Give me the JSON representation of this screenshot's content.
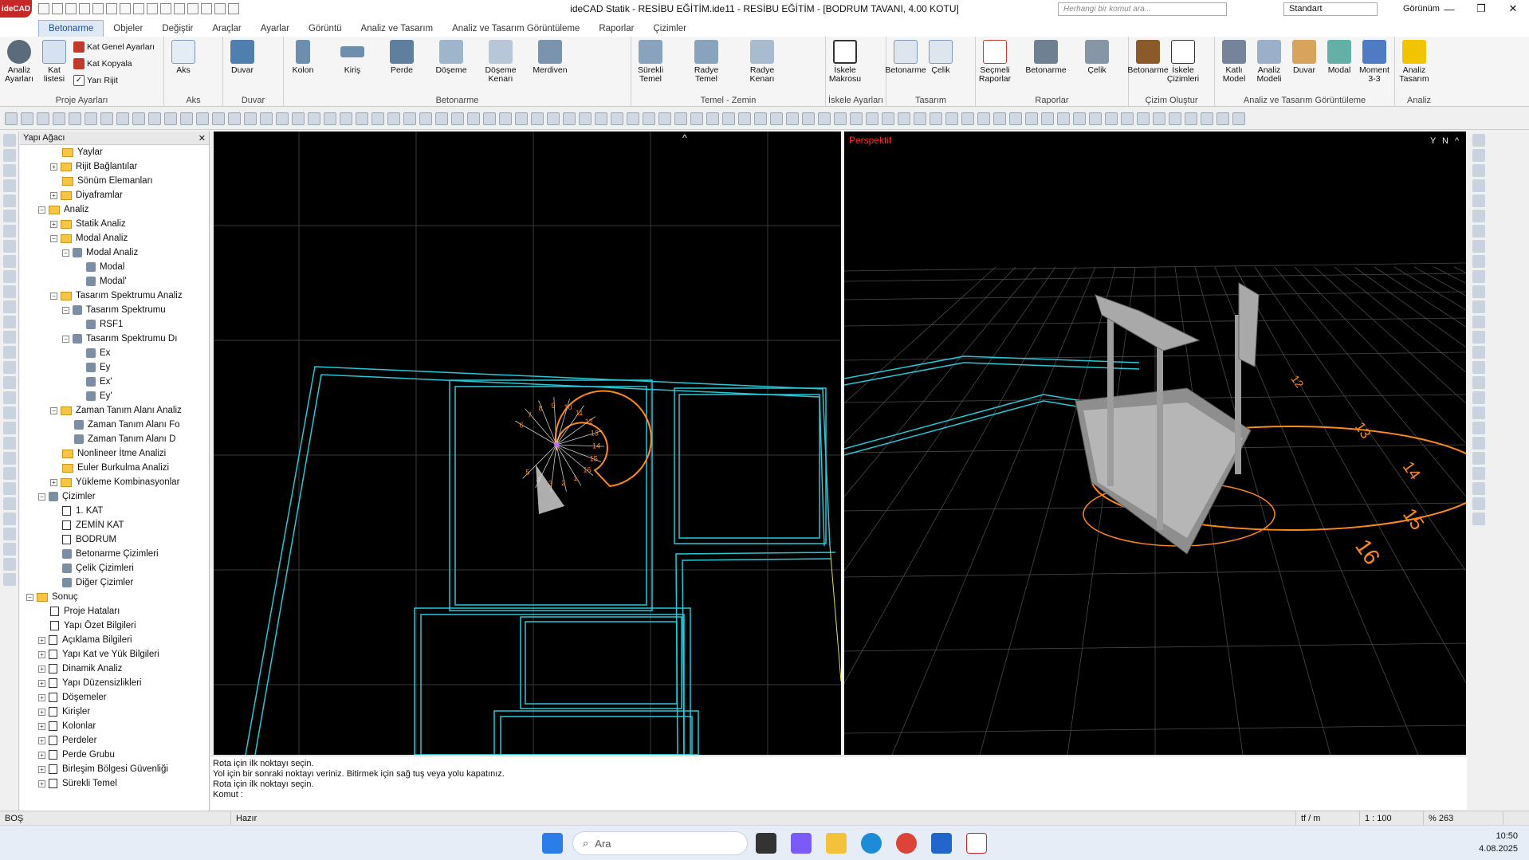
{
  "window": {
    "title": "ideCAD Statik - RESİBU EĞİTİM.ide11 - RESİBU EĞİTİM - [BODRUM TAVANI,  4.00 KOTU]",
    "logo": "ideCAD",
    "minimize": "—",
    "maximize": "❐",
    "close": "✕"
  },
  "tabs": [
    "Betonarme",
    "Objeler",
    "Değiştir",
    "Araçlar",
    "Ayarlar",
    "Görüntü",
    "Analiz ve Tasarım",
    "Analiz ve Tasarım Görüntüleme",
    "Raporlar",
    "Çizimler"
  ],
  "search": {
    "placeholder": "Herhangi bir komut ara..."
  },
  "style_select": "Standart",
  "view_menu": "Görünüm",
  "ribbon": {
    "proje": {
      "title": "Proje Ayarları",
      "analiz": "Analiz Ayarları",
      "kat": "Kat listesi",
      "kat_genel": "Kat Genel Ayarları",
      "kat_kopyala": "Kat Kopyala",
      "yari_rijit": "Yarı Rijit"
    },
    "aks": {
      "title": "Aks",
      "aks": "Aks"
    },
    "duvar": {
      "title": "Duvar",
      "duvar": "Duvar"
    },
    "betonarme": {
      "title": "Betonarme",
      "kolon": "Kolon",
      "kiris": "Kiriş",
      "perde": "Perde",
      "doseme": "Döşeme",
      "doseme_kenari": "Döşeme Kenarı",
      "merdiven": "Merdiven"
    },
    "temel": {
      "title": "Temel - Zemin",
      "surekli": "Sürekli Temel",
      "radye": "Radye Temel",
      "radye_kenari": "Radye Kenarı"
    },
    "iskele": {
      "title": "İskele Ayarları",
      "makrosu": "İskele Makrosu"
    },
    "tasarim": {
      "title": "Tasarım",
      "betonarme": "Betonarme",
      "celik": "Çelik"
    },
    "raporlar": {
      "title": "Raporlar",
      "secmeli": "Seçmeli Raporlar",
      "betonarme": "Betonarme",
      "celik": "Çelik"
    },
    "cizim": {
      "title": "Çizim Oluştur",
      "betonarme": "Betonarme",
      "iskele": "İskele Çizimleri"
    },
    "goruntuleme": {
      "title": "Analiz ve Tasarım Görüntüleme",
      "katli": "Katlı Model",
      "analiz_modeli": "Analiz Modeli",
      "duvar": "Duvar",
      "modal": "Modal",
      "moment": "Moment 3-3"
    },
    "analiz": {
      "title": "Analiz",
      "analiz_tasarim": "Analiz Tasarım"
    }
  },
  "tree": {
    "header": "Yapı Ağacı",
    "items": [
      {
        "label": "Yaylar",
        "indent": 3,
        "kind": "folder"
      },
      {
        "label": "Rijit Bağlantılar",
        "indent": 2,
        "kind": "folder",
        "exp": "+"
      },
      {
        "label": "Sönüm Elemanları",
        "indent": 3,
        "kind": "folder"
      },
      {
        "label": "Diyaframlar",
        "indent": 2,
        "kind": "folder",
        "exp": "+"
      },
      {
        "label": "Analiz",
        "indent": 1,
        "kind": "folder",
        "exp": "−"
      },
      {
        "label": "Statik Analiz",
        "indent": 2,
        "kind": "folder",
        "exp": "+"
      },
      {
        "label": "Modal Analiz",
        "indent": 2,
        "kind": "folder",
        "exp": "−"
      },
      {
        "label": "Modal Analiz",
        "indent": 3,
        "kind": "leaf",
        "exp": "−"
      },
      {
        "label": "Modal",
        "indent": 5,
        "kind": "leaf"
      },
      {
        "label": "Modal'",
        "indent": 5,
        "kind": "leaf"
      },
      {
        "label": "Tasarım Spektrumu Analiz",
        "indent": 2,
        "kind": "folder",
        "exp": "−"
      },
      {
        "label": "Tasarım Spektrumu",
        "indent": 3,
        "kind": "leaf",
        "exp": "−"
      },
      {
        "label": "RSF1",
        "indent": 5,
        "kind": "leaf"
      },
      {
        "label": "Tasarım Spektrumu Dı",
        "indent": 3,
        "kind": "leaf",
        "exp": "−"
      },
      {
        "label": "Ex",
        "indent": 5,
        "kind": "leaf"
      },
      {
        "label": "Ey",
        "indent": 5,
        "kind": "leaf"
      },
      {
        "label": "Ex'",
        "indent": 5,
        "kind": "leaf"
      },
      {
        "label": "Ey'",
        "indent": 5,
        "kind": "leaf"
      },
      {
        "label": "Zaman Tanım Alanı Analiz",
        "indent": 2,
        "kind": "folder",
        "exp": "−"
      },
      {
        "label": "Zaman Tanım Alanı Fo",
        "indent": 4,
        "kind": "leaf"
      },
      {
        "label": "Zaman Tanım Alanı D",
        "indent": 4,
        "kind": "leaf"
      },
      {
        "label": "Nonlineer İtme Analizi",
        "indent": 3,
        "kind": "folder"
      },
      {
        "label": "Euler Burkulma Analizi",
        "indent": 3,
        "kind": "folder"
      },
      {
        "label": "Yükleme Kombinasyonlar",
        "indent": 2,
        "kind": "folder",
        "exp": "+"
      },
      {
        "label": "Çizimler",
        "indent": 1,
        "kind": "leaf",
        "exp": "−"
      },
      {
        "label": "1. KAT",
        "indent": 3,
        "kind": "doc"
      },
      {
        "label": "ZEMİN KAT",
        "indent": 3,
        "kind": "doc"
      },
      {
        "label": "BODRUM",
        "indent": 3,
        "kind": "doc"
      },
      {
        "label": "Betonarme Çizimleri",
        "indent": 3,
        "kind": "leaf"
      },
      {
        "label": "Çelik Çizimleri",
        "indent": 3,
        "kind": "leaf"
      },
      {
        "label": "Diğer Çizimler",
        "indent": 3,
        "kind": "leaf"
      },
      {
        "label": "Sonuç",
        "indent": 0,
        "kind": "folder",
        "exp": "−"
      },
      {
        "label": "Proje Hataları",
        "indent": 2,
        "kind": "doc"
      },
      {
        "label": "Yapı Özet Bilgileri",
        "indent": 2,
        "kind": "doc"
      },
      {
        "label": "Açıklama Bilgileri",
        "indent": 1,
        "kind": "doc",
        "exp": "+"
      },
      {
        "label": "Yapı Kat ve Yük Bilgileri",
        "indent": 1,
        "kind": "doc",
        "exp": "+"
      },
      {
        "label": "Dinamik Analiz",
        "indent": 1,
        "kind": "doc",
        "exp": "+"
      },
      {
        "label": "Yapı Düzensizlikleri",
        "indent": 1,
        "kind": "doc",
        "exp": "+"
      },
      {
        "label": "Döşemeler",
        "indent": 1,
        "kind": "doc",
        "exp": "+"
      },
      {
        "label": "Kirişler",
        "indent": 1,
        "kind": "doc",
        "exp": "+"
      },
      {
        "label": "Kolonlar",
        "indent": 1,
        "kind": "doc",
        "exp": "+"
      },
      {
        "label": "Perdeler",
        "indent": 1,
        "kind": "doc",
        "exp": "+"
      },
      {
        "label": "Perde Grubu",
        "indent": 1,
        "kind": "doc",
        "exp": "+"
      },
      {
        "label": "Birleşim Bölgesi Güvenliği",
        "indent": 1,
        "kind": "doc",
        "exp": "+"
      },
      {
        "label": "Sürekli Temel",
        "indent": 1,
        "kind": "doc",
        "exp": "+"
      }
    ]
  },
  "viewport": {
    "right_label": "Perspektif",
    "stair_numbers": [
      "1",
      "2",
      "3",
      "4",
      "5",
      "6",
      "7",
      "8",
      "9",
      "10",
      "11",
      "12",
      "13",
      "14",
      "15",
      "16"
    ]
  },
  "command": {
    "lines": [
      "Rota için ilk noktayı seçin.",
      "Yol için bir sonraki noktayı veriniz. Bitirmek için sağ tuş veya yolu kapatınız.",
      "Rota için ilk noktayı seçin.",
      "Komut :"
    ]
  },
  "status": {
    "left": "BOŞ",
    "state": "Hazır",
    "unit": "tf / m",
    "scale": "1 : 100",
    "zoom": "% 263"
  },
  "taskbar": {
    "search": "Ara",
    "time": "10:50",
    "date": "4.08.2025"
  },
  "colors": {
    "cyan": "#27c9d9",
    "orange": "#ff8a1c",
    "accent": "#1a4fa0"
  }
}
